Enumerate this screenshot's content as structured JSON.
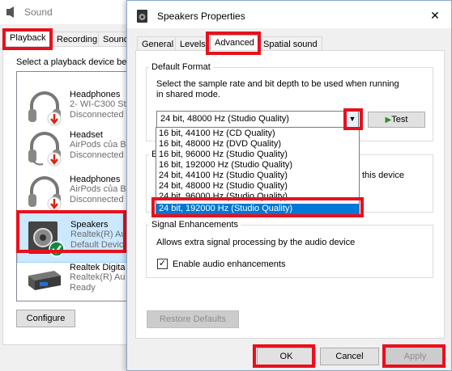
{
  "sound_window": {
    "title": "Sound",
    "tabs": [
      "Playback",
      "Recording",
      "Sound"
    ],
    "instruction": "Select a playback device be",
    "devices": [
      {
        "name": "Headphones",
        "line1": "2- WI-C300 Ste",
        "line2": "Disconnected"
      },
      {
        "name": "Headset",
        "line1": "AirPods của Ba",
        "line2": "Disconnected"
      },
      {
        "name": "Headphones",
        "line1": "AirPods của Ba",
        "line2": "Disconnected"
      },
      {
        "name": "Speakers",
        "line1": "Realtek(R) Au",
        "line2": "Default Devic"
      },
      {
        "name": "Realtek Digita",
        "line1": "Realtek(R) Au",
        "line2": "Ready"
      }
    ],
    "configure_label": "Configure"
  },
  "dialog": {
    "title": "Speakers Properties",
    "close_glyph": "✕",
    "tabs": [
      "General",
      "Levels",
      "Advanced",
      "Spatial sound"
    ],
    "default_format": {
      "group_label": "Default Format",
      "description_line1": "Select the sample rate and bit depth to be used when running",
      "description_line2": "in shared mode.",
      "selected_value": "24 bit, 48000 Hz (Studio Quality)",
      "test_label": "Test",
      "options": [
        "16 bit, 44100 Hz (CD Quality)",
        "16 bit, 48000 Hz (DVD Quality)",
        "16 bit, 96000 Hz (Studio Quality)",
        "16 bit, 192000 Hz (Studio Quality)",
        "24 bit, 44100 Hz (Studio Quality)",
        "24 bit, 48000 Hz (Studio Quality)",
        "24 bit, 96000 Hz (Studio Quality)",
        "24 bit, 192000 Hz (Studio Quality)"
      ],
      "highlighted_index": 7
    },
    "exclusive_mode": {
      "group_label_fragment": "E",
      "text_fragment": "this device"
    },
    "signal_enhancements": {
      "group_label": "Signal Enhancements",
      "description": "Allows extra signal processing by the audio device",
      "checkbox_label": "Enable audio enhancements",
      "checked": true
    },
    "restore_defaults_label": "Restore Defaults",
    "ok_label": "OK",
    "cancel_label": "Cancel",
    "apply_label": "Apply"
  },
  "colors": {
    "annotation_red": "#e8101d",
    "selection_blue": "#0078d7",
    "list_selection": "#cce8ff"
  }
}
